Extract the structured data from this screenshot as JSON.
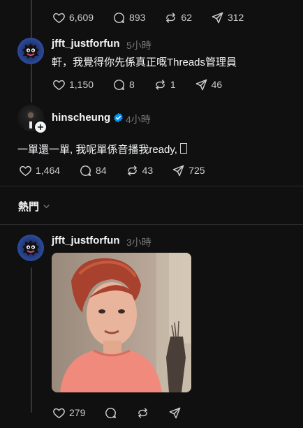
{
  "top_post": {
    "likes": "6,609",
    "replies": "893",
    "reposts": "62",
    "shares": "312"
  },
  "reply_jfft": {
    "username": "jfft_justforfun",
    "time": "5小時",
    "text": "軒，我覺得你先係真正嘅Threads管理員",
    "likes": "1,150",
    "replies": "8",
    "reposts": "1",
    "shares": "46"
  },
  "reply_hins": {
    "username": "hinscheung",
    "time": "4小時",
    "text": "一單還一單, 我呢單係音播我ready, ",
    "likes": "1,464",
    "replies": "84",
    "reposts": "43",
    "shares": "725"
  },
  "sort": {
    "label": "熱門"
  },
  "popular_post": {
    "username": "jfft_justforfun",
    "time": "3小時",
    "likes": "279"
  },
  "colors": {
    "background": "#101010",
    "verified_badge": "#0095f6",
    "muted_text": "#777777"
  }
}
